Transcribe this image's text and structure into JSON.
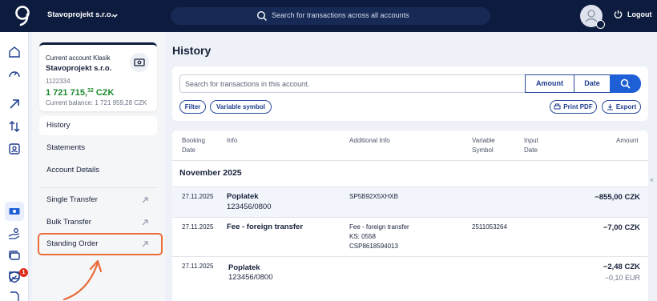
{
  "topbar": {
    "company": "Stavoprojekt s.r.o.",
    "search_placeholder": "Search for transactions across all accounts",
    "logout": "Logout"
  },
  "account": {
    "type": "Current account Klasik",
    "name": "Stavoprojekt s.r.o.",
    "number": "1122334",
    "balance_main": "1 721 715,",
    "balance_cents": "32",
    "balance_currency": "CZK",
    "current_balance": "Current balance: 1 721 959,28 CZK"
  },
  "nav": {
    "history": "History",
    "statements": "Statements",
    "account_details": "Account Details",
    "single_transfer": "Single Transfer",
    "bulk_transfer": "Bulk Transfer",
    "standing_order": "Standing Order"
  },
  "main": {
    "title": "History",
    "search_placeholder": "Search for transactions in this account.",
    "amount_btn": "Amount",
    "date_btn": "Date",
    "filter_btn": "Filter",
    "variable_symbol_btn": "Variable symbol",
    "print_btn": "Print PDF",
    "export_btn": "Export"
  },
  "table": {
    "headers": {
      "booking_date_1": "Booking",
      "booking_date_2": "Date",
      "info": "Info",
      "additional": "Additional Info",
      "vs_1": "Variable",
      "vs_2": "Symbol",
      "input_1": "Input",
      "input_2": "Date",
      "amount": "Amount"
    },
    "month": "November 2025",
    "rows": [
      {
        "date": "27.11.2025",
        "title": "Poplatek",
        "subtitle": "123456/0800",
        "additional": [
          "SP5B92X5XHXB"
        ],
        "vs": "",
        "amount": "−855,00 CZK",
        "amount_sub": ""
      },
      {
        "date": "27.11.2025",
        "title": "Fee - foreign transfer",
        "subtitle": "",
        "additional": [
          "Fee - foreign transfer",
          "KS: 0558",
          "CSP8618594013"
        ],
        "vs": "2511053264",
        "amount": "−7,00 CZK",
        "amount_sub": ""
      },
      {
        "date": "27.11.2025",
        "title": "Poplatek",
        "subtitle": "123456/0800",
        "additional": [],
        "vs": "",
        "amount": "−2,48 CZK",
        "amount_sub": "−0,10 EUR"
      }
    ]
  },
  "notifications_count": "1",
  "colors": {
    "navy": "#0d1b3e",
    "accent_blue": "#1f5fd6",
    "positive_green": "#1c8a2e",
    "highlight_orange": "#ea6d3c"
  }
}
